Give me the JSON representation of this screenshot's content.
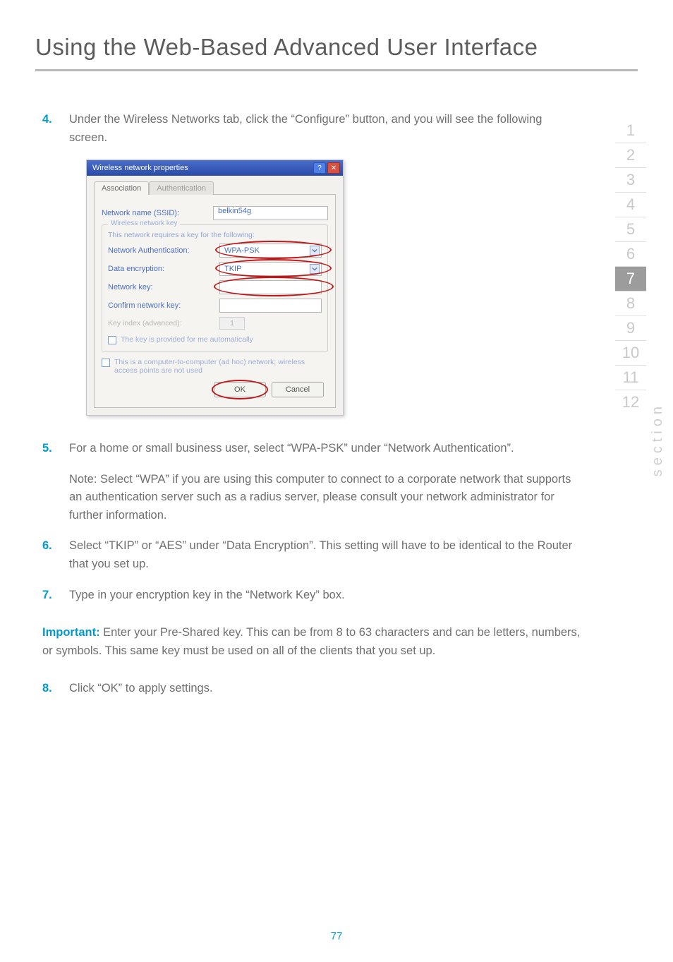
{
  "page": {
    "title": "Using the Web-Based Advanced User Interface",
    "number": "77"
  },
  "section_nav": {
    "label": "section",
    "items": [
      "1",
      "2",
      "3",
      "4",
      "5",
      "6",
      "7",
      "8",
      "9",
      "10",
      "11",
      "12"
    ],
    "active": "7"
  },
  "steps": {
    "s4": {
      "num": "4.",
      "text": "Under the Wireless Networks tab, click the “Configure” button, and you will see the following screen."
    },
    "s5": {
      "num": "5.",
      "text": "For a home or small business user, select “WPA-PSK” under “Network Authentication”."
    },
    "s5_note": {
      "label": "Note:",
      "text": " Select “WPA” if you are using this computer to connect to a corporate network that supports an authentication server such as a radius server, please consult your network administrator for further information."
    },
    "s6": {
      "num": "6.",
      "text": "Select “TKIP” or “AES” under “Data Encryption”. This setting will have to be identical to the Router that you set up."
    },
    "s7": {
      "num": "7.",
      "text": "Type in your encryption key in the “Network Key” box."
    },
    "important": {
      "label": "Important:",
      "text": " Enter your Pre-Shared key. This can be from 8 to 63 characters and can be letters, numbers, or symbols. This same key must be used on all of the clients that you set up."
    },
    "s8": {
      "num": "8.",
      "text": "Click “OK” to apply settings."
    }
  },
  "dialog": {
    "title": "Wireless network properties",
    "help_btn": "?",
    "close_btn": "✕",
    "tabs": {
      "association": "Association",
      "authentication": "Authentication"
    },
    "fields": {
      "ssid_label": "Network name (SSID):",
      "ssid_value": "belkin54g",
      "group_legend": "Wireless network key",
      "group_hint": "This network requires a key for the following:",
      "net_auth_label": "Network Authentication:",
      "net_auth_value": "WPA-PSK",
      "data_enc_label": "Data encryption:",
      "data_enc_value": "TKIP",
      "net_key_label": "Network key:",
      "confirm_key_label": "Confirm network key:",
      "key_index_label": "Key index (advanced):",
      "key_index_value": "1",
      "auto_key_label": "The key is provided for me automatically",
      "adhoc_label": "This is a computer-to-computer (ad hoc) network; wireless access points are not used"
    },
    "buttons": {
      "ok": "OK",
      "cancel": "Cancel"
    }
  }
}
